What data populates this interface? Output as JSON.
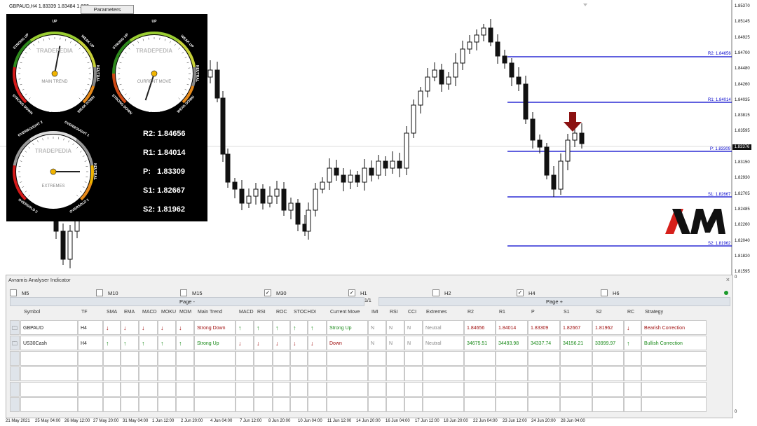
{
  "chart": {
    "symbol_title": "GBPAUD,H4  1.83339 1.83484 1.832",
    "params_label": "Parameters",
    "current_price": "1.83376",
    "price_ticks": [
      "1.85370",
      "1.85145",
      "1.84925",
      "1.84700",
      "1.84480",
      "1.84260",
      "1.84035",
      "1.83815",
      "1.83595",
      "1.83376",
      "1.83150",
      "1.82930",
      "1.82705",
      "1.82485",
      "1.82260",
      "1.82040",
      "1.81820",
      "1.81595"
    ],
    "pivot_tags": {
      "r2": "R2: 1.84656",
      "r1": "R1: 1.84014",
      "p": "P: 1.83309",
      "s1": "S1: 1.82667",
      "s2": "S2: 1.81962"
    },
    "time_ticks": [
      "21 May 2021",
      "25 May 04:00",
      "26 May 12:00",
      "27 May 20:00",
      "31 May 04:00",
      "1 Jun 12:00",
      "2 Jun 20:00",
      "4 Jun 04:00",
      "7 Jun 12:00",
      "8 Jun 20:00",
      "10 Jun 04:00",
      "11 Jun 12:00",
      "14 Jun 20:00",
      "16 Jun 04:00",
      "17 Jun 12:00",
      "18 Jun 20:00",
      "22 Jun 04:00",
      "23 Jun 12:00",
      "24 Jun 20:00",
      "28 Jun 04:00"
    ],
    "sub_axis": {
      "top": "0",
      "bottom": "0"
    },
    "colors": {
      "pivot_line": "#0000cc",
      "arrow": "#8b1111"
    }
  },
  "dashboard": {
    "gauge1": {
      "up": "UP",
      "strong_up": "STRONG UP",
      "weak_up": "WEAK UP",
      "neutral": "NEUTRAL",
      "strong_down": "STRONG DOWN",
      "down": "DOWN",
      "weak_down": "WEAK DOWN",
      "brand": "TRADEPEDIA",
      "label": "MAIN TREND"
    },
    "gauge2": {
      "up": "UP",
      "strong_up": "STRONG UP",
      "weak_up": "WEAK UP",
      "neutral": "NEUTRAL",
      "strong_down": "STRONG DOWN",
      "down": "DOWN",
      "weak_down": "WEAK DOWN",
      "brand": "TRADEPEDIA",
      "label": "CURRENT MOVE"
    },
    "gauge3": {
      "overbought2": "OVERBOUGHT 2",
      "overbought1": "OVERBOUGHT 1",
      "neutral": "NEUTRAL",
      "oversold2": "OVERSOLD 2",
      "oversold1": "OVERSOLD 1",
      "brand": "TRADEPEDIA",
      "label": "EXTREMES"
    },
    "pivots": {
      "r2": "R2: 1.84656",
      "r1": "R1: 1.84014",
      "p": "P:   1.83309",
      "s1": "S1: 1.82667",
      "s2": "S2: 1.81962"
    }
  },
  "indicator": {
    "title": "Avramis Analyser Indicator",
    "close": "×",
    "timeframes": [
      {
        "label": "M5",
        "checked": false
      },
      {
        "label": "M10",
        "checked": false
      },
      {
        "label": "M15",
        "checked": false
      },
      {
        "label": "M30",
        "checked": true
      },
      {
        "label": "H1",
        "checked": true
      },
      {
        "label": "H2",
        "checked": false
      },
      {
        "label": "H4",
        "checked": true
      },
      {
        "label": "H6",
        "checked": false
      }
    ],
    "page_minus": "Page -",
    "page_num": "1/1",
    "page_plus": "Page +",
    "headers": [
      "Symbol",
      "TF",
      "SMA",
      "EMA",
      "MACD",
      "MOKU",
      "MOM",
      "Main Trend",
      "MACD",
      "RSI",
      "ROC",
      "STOCH",
      "DI",
      "Current Move",
      "IMI",
      "RSI",
      "CCI",
      "Extremes",
      "R2",
      "R1",
      "P",
      "S1",
      "S2",
      "RC",
      "Strategy"
    ],
    "rows": [
      {
        "icon": "folder-icon",
        "symbol": "GBPAUD",
        "tf": "H4",
        "sma": "↓",
        "ema": "↓",
        "macd": "↓",
        "moku": "↓",
        "mom": "↓",
        "main_trend": "Strong Down",
        "macd2": "↑",
        "rsi": "↑",
        "roc": "↑",
        "stoch": "↑",
        "di": "↑",
        "current_move": "Strong Up",
        "imi": "N",
        "rsi2": "N",
        "cci": "N",
        "extremes": "Neutral",
        "r2": "1.84656",
        "r1": "1.84014",
        "p": "1.83309",
        "s1": "1.82667",
        "s2": "1.81962",
        "rc": "↓",
        "strategy": "Bearish Correction"
      },
      {
        "icon": "folder-icon",
        "symbol": "US30Cash",
        "tf": "H4",
        "sma": "↑",
        "ema": "↑",
        "macd": "↑",
        "moku": "↑",
        "mom": "↑",
        "main_trend": "Strong Up",
        "macd2": "↓",
        "rsi": "↓",
        "roc": "↓",
        "stoch": "↓",
        "di": "↓",
        "current_move": "Down",
        "imi": "N",
        "rsi2": "N",
        "cci": "N",
        "extremes": "Neutral",
        "r2": "34675.51",
        "r1": "34493.98",
        "p": "34337.74",
        "s1": "34156.21",
        "s2": "33999.97",
        "rc": "↑",
        "strategy": "Bullish Correction"
      }
    ]
  }
}
